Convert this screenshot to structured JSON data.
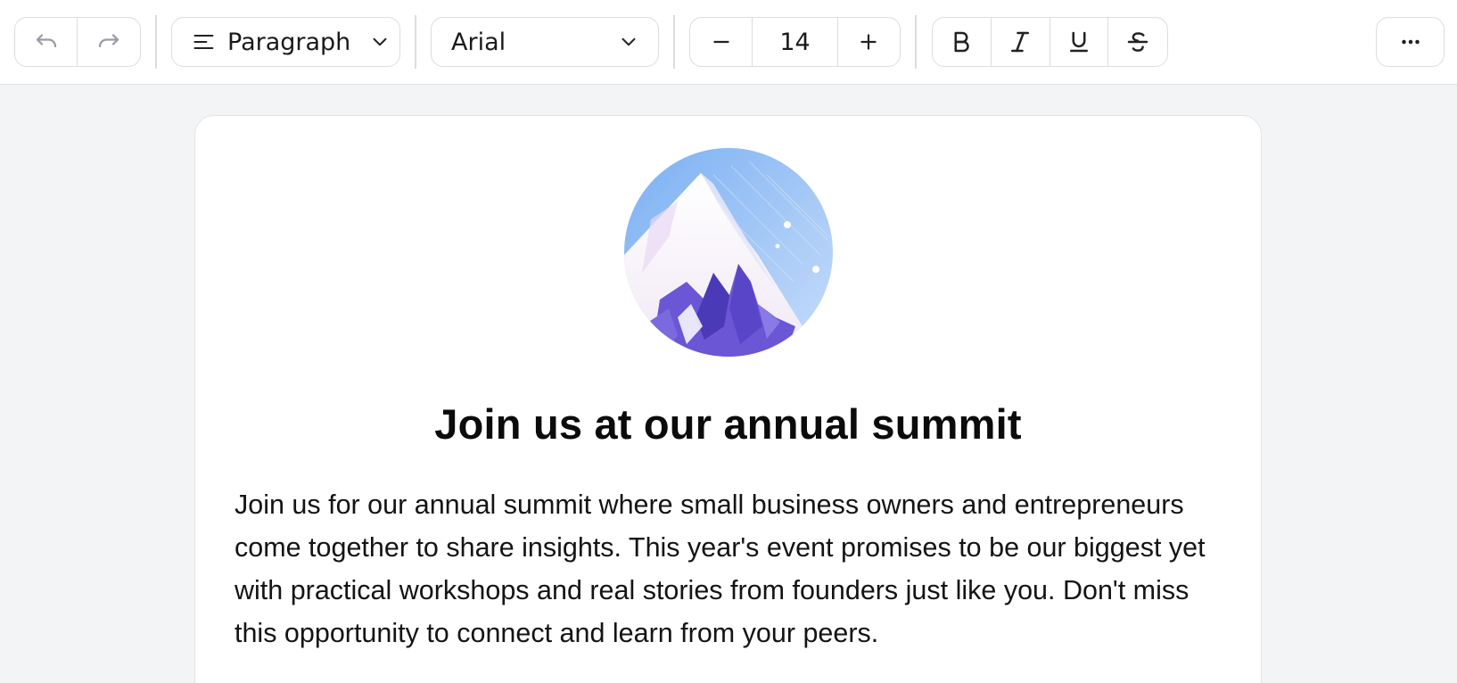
{
  "toolbar": {
    "undo_icon": "undo-icon",
    "redo_icon": "redo-icon",
    "block_type": {
      "icon": "align-left-icon",
      "label": "Paragraph"
    },
    "font_family": {
      "label": "Arial"
    },
    "font_size": {
      "value": "14",
      "decrease_icon": "minus-icon",
      "increase_icon": "plus-icon"
    },
    "format": [
      "bold-icon",
      "italic-icon",
      "underline-icon",
      "strikethrough-icon"
    ],
    "more_icon": "more-horizontal-icon"
  },
  "document": {
    "image": "mountain-illustration",
    "heading": "Join us at our annual summit",
    "body": "Join us for our annual summit where small business owners and entrepreneurs come together to share insights. This year's event promises to be our biggest yet with practical workshops and real stories from founders just like you. Don't miss this opportunity to connect and learn from your peers."
  },
  "colors": {
    "toolbar_bg": "#ffffff",
    "page_bg": "#f3f4f6",
    "border": "#dcdde1",
    "text": "#111111"
  }
}
